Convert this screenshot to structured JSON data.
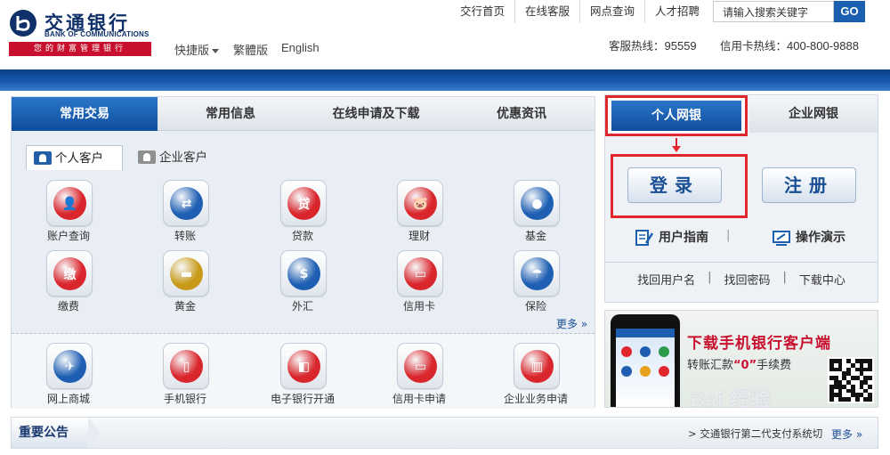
{
  "brand": {
    "name_cn": "交通银行",
    "name_en": "BANK OF COMMUNICATIONS",
    "slogan": "您的财富管理银行",
    "logo_color": "#10306a",
    "slogan_bg": "#c8102e"
  },
  "lang_links": {
    "quick": "快捷版",
    "traditional": "繁體版",
    "english": "English"
  },
  "top_nav": [
    "交行首页",
    "在线客服",
    "网点查询",
    "人才招聘"
  ],
  "search": {
    "value": "请输入搜索关键字",
    "button": "GO"
  },
  "hotlines": {
    "service_label": "客服热线：",
    "service_number": "95559",
    "card_label": "信用卡热线：",
    "card_number": "400-800-9888"
  },
  "main_tabs": [
    {
      "label": "常用交易",
      "active": true
    },
    {
      "label": "常用信息",
      "active": false
    },
    {
      "label": "在线申请及下载",
      "active": false
    },
    {
      "label": "优惠资讯",
      "active": false
    }
  ],
  "customer_tabs": {
    "personal": "个人客户",
    "business": "企业客户"
  },
  "services": [
    {
      "label": "账户查询",
      "icon": "account-inquiry-icon",
      "color": "#d9262c",
      "glyph": "👤"
    },
    {
      "label": "转账",
      "icon": "transfer-icon",
      "color": "#1e5fb3",
      "glyph": "⇄"
    },
    {
      "label": "贷款",
      "icon": "loan-icon",
      "color": "#d9262c",
      "glyph": "贷"
    },
    {
      "label": "理财",
      "icon": "wealth-piggy-icon",
      "color": "#d9262c",
      "glyph": "🐷"
    },
    {
      "label": "基金",
      "icon": "fund-coins-icon",
      "color": "#1e5fb3",
      "glyph": "●"
    },
    {
      "label": "缴费",
      "icon": "payment-icon",
      "color": "#d9262c",
      "glyph": "缴"
    },
    {
      "label": "黄金",
      "icon": "gold-bar-icon",
      "color": "#c99a1a",
      "glyph": "▬"
    },
    {
      "label": "外汇",
      "icon": "forex-icon",
      "color": "#1e5fb3",
      "glyph": "$"
    },
    {
      "label": "信用卡",
      "icon": "credit-card-icon",
      "color": "#d9262c",
      "glyph": "▭"
    },
    {
      "label": "保险",
      "icon": "insurance-umbrella-icon",
      "color": "#1e5fb3",
      "glyph": "☂"
    }
  ],
  "more_label": "更多 »",
  "quick_services": [
    {
      "label": "网上商城",
      "icon": "online-mall-icon",
      "color": "#1e5fb3",
      "glyph": "✈"
    },
    {
      "label": "手机银行",
      "icon": "mobile-bank-icon",
      "color": "#d9262c",
      "glyph": "▯"
    },
    {
      "label": "电子银行开通",
      "icon": "ebank-open-icon",
      "color": "#d9262c",
      "glyph": "◧"
    },
    {
      "label": "信用卡申请",
      "icon": "card-apply-icon",
      "color": "#d9262c",
      "glyph": "▭"
    },
    {
      "label": "企业业务申请",
      "icon": "business-apply-icon",
      "color": "#d9262c",
      "glyph": "▥"
    }
  ],
  "ebank": {
    "personal_tab": "个人网银",
    "business_tab": "企业网银",
    "login": "登录",
    "register": "注册",
    "user_guide": "用户指南",
    "demo": "操作演示",
    "separator": "|",
    "links": [
      "找回用户名",
      "找回密码",
      "下载中心"
    ]
  },
  "mobile_ad": {
    "title": "下载手机银行客户端",
    "sub_prefix": "转账汇款",
    "sub_highlight": "“0”",
    "sub_suffix": "手续费",
    "watermark": "Bai 经验"
  },
  "notice": {
    "tag": "重要公告",
    "text": "> 交通银行第二代支付系统切",
    "more": "更多 »"
  },
  "colors": {
    "accent_blue": "#1a5fb0",
    "highlight_red": "#e1262d",
    "tab_active": "#0f4d9d"
  }
}
